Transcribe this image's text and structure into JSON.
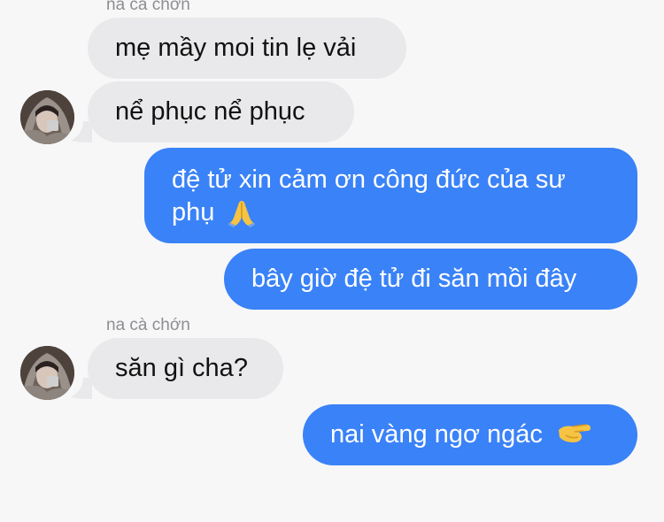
{
  "messages": [
    {
      "sender": "na cà chớn",
      "text": "mẹ mầy moi tin lẹ vải"
    },
    {
      "text": "nể phục nể phục"
    },
    {
      "text": "đệ tử xin cảm ơn công đức của sư phụ",
      "emoji_icon": "folded-hands-emoji"
    },
    {
      "text": "bây giờ đệ tử đi săn mồi đây"
    },
    {
      "sender": "na cà chớn",
      "text": "săn gì cha?"
    },
    {
      "text": "nai vàng ngơ ngác",
      "emoji_icon": "pinching-hand-emoji"
    }
  ],
  "colors": {
    "background": "#f7f7f7",
    "incoming_bubble": "#e9e9eb",
    "outgoing_bubble": "#3a82f7",
    "sender_name": "#8e8e93"
  }
}
